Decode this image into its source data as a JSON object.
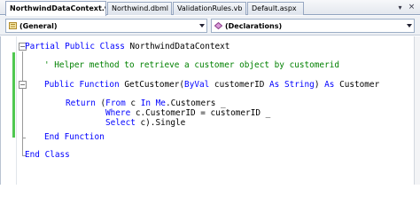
{
  "tabs": [
    {
      "label": "NorthwindDataContext.vb",
      "active": true
    },
    {
      "label": "Northwind.dbml",
      "active": false
    },
    {
      "label": "ValidationRules.vb",
      "active": false
    },
    {
      "label": "Default.aspx",
      "active": false
    }
  ],
  "tabstrip": {
    "menu_icon": "dropdown-icon",
    "close_icon": "close-icon",
    "close_glyph": "×",
    "menu_glyph": "▾"
  },
  "navbar": {
    "left_combo": {
      "value": "(General)",
      "icon": "class-icon"
    },
    "right_combo": {
      "value": "(Declarations)",
      "icon": "method-icon"
    }
  },
  "code": {
    "line1": {
      "kw": "Partial Public Class ",
      "tx": "NorthwindDataContext"
    },
    "line2": {
      "cm": "' Helper method to retrieve a customer object by customerid"
    },
    "line3": {
      "kw1": "Public Function ",
      "tx1": "GetCustomer(",
      "kw2": "ByVal ",
      "tx2": "customerID ",
      "kw3": "As String",
      "tx3": ") ",
      "kw4": "As ",
      "tx4": "Customer"
    },
    "line4": {
      "kw1": "Return ",
      "tx1": "(",
      "kw2": "From ",
      "tx2": "c ",
      "kw3": "In Me",
      "tx3": ".Customers _"
    },
    "line5": {
      "kw1": "Where ",
      "tx1": "c.CustomerID = customerID _"
    },
    "line6": {
      "kw1": "Select ",
      "tx1": "c).Single"
    },
    "line7": {
      "kw": "End Function"
    },
    "line8": {
      "kw": "End Class"
    }
  },
  "colors": {
    "keyword": "#0000ff",
    "comment": "#008000",
    "change_bar": "#50c850"
  }
}
